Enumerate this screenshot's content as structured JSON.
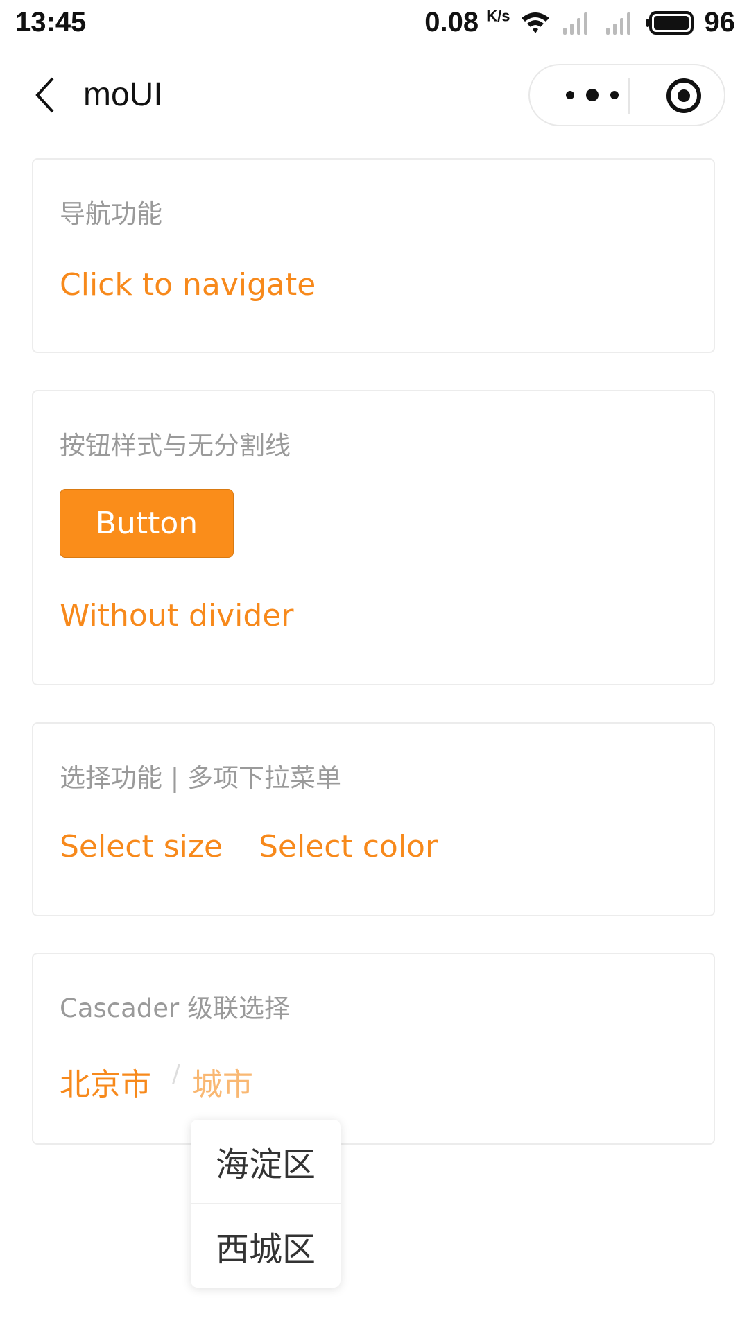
{
  "status_bar": {
    "time": "13:45",
    "speed": "0.08",
    "speed_unit": "K/s",
    "battery": "96",
    "icons": [
      "wifi-icon",
      "signal-icon",
      "signal-icon",
      "battery-icon"
    ]
  },
  "nav": {
    "title": "moUI",
    "icons": [
      "back-icon",
      "more-icon",
      "close-target-icon"
    ]
  },
  "colors": {
    "accent": "#f7891b",
    "accent_light": "#f9b873",
    "button_bg": "#fa8d1a",
    "muted": "#9a9a9a"
  },
  "cards": {
    "navigation": {
      "title": "导航功能",
      "link": "Click to navigate"
    },
    "button": {
      "title": "按钮样式与无分割线",
      "button_label": "Button",
      "link": "Without divider"
    },
    "select": {
      "title": "选择功能 | 多项下拉菜单",
      "size_link": "Select size",
      "color_link": "Select color"
    },
    "cascader": {
      "title": "Cascader 级联选择",
      "level1": "北京市",
      "separator": "/",
      "level2": "城市",
      "options": [
        "海淀区",
        "西城区"
      ]
    }
  }
}
